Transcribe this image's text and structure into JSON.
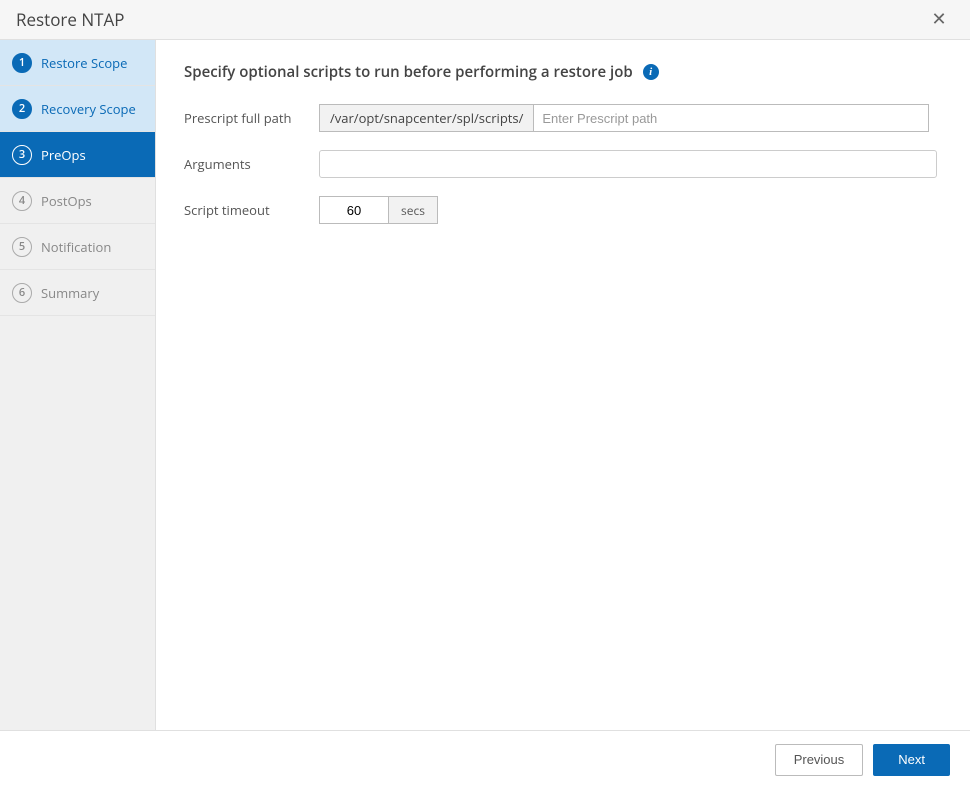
{
  "title": "Restore NTAP",
  "sidebar": {
    "steps": [
      {
        "num": "1",
        "label": "Restore Scope"
      },
      {
        "num": "2",
        "label": "Recovery Scope"
      },
      {
        "num": "3",
        "label": "PreOps"
      },
      {
        "num": "4",
        "label": "PostOps"
      },
      {
        "num": "5",
        "label": "Notification"
      },
      {
        "num": "6",
        "label": "Summary"
      }
    ]
  },
  "main": {
    "heading": "Specify optional scripts to run before performing a restore job",
    "prescript": {
      "label": "Prescript full path",
      "prefix": "/var/opt/snapcenter/spl/scripts/",
      "placeholder": "Enter Prescript path",
      "value": ""
    },
    "arguments": {
      "label": "Arguments",
      "value": ""
    },
    "timeout": {
      "label": "Script timeout",
      "value": "60",
      "unit": "secs"
    }
  },
  "footer": {
    "previous": "Previous",
    "next": "Next"
  }
}
